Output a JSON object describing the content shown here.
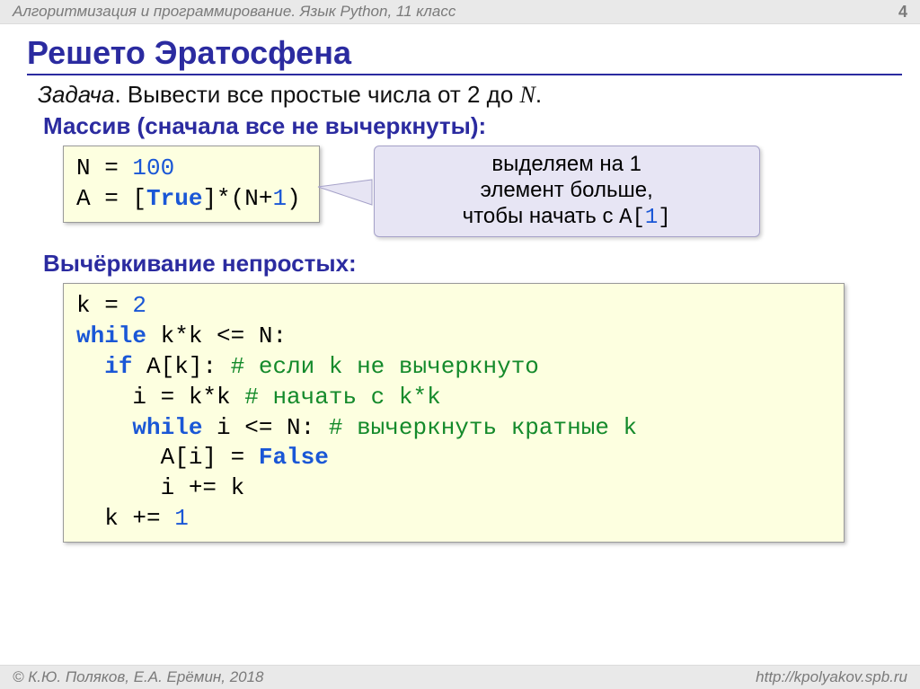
{
  "header": {
    "course": "Алгоритмизация и программирование. Язык Python, 11 класс",
    "page": "4"
  },
  "title": "Решето Эратосфена",
  "task": {
    "label": "Задача",
    "body_before": ". Вывести все простые числа от 2 до ",
    "N": "N",
    "body_after": "."
  },
  "subhead_array": "Массив (сначала все не вычеркнуты):",
  "code1": {
    "l1a": "N",
    "l1b": " = ",
    "l1c": "100",
    "l2a": "A",
    "l2b": " = [",
    "l2c": "True",
    "l2d": "]*(N+",
    "l2e": "1",
    "l2f": ")"
  },
  "note": {
    "line1": "выделяем на 1",
    "line2": "элемент больше,",
    "line3a": "чтобы начать с ",
    "line3b": "A[",
    "line3c": "1",
    "line3d": "]"
  },
  "subhead_cross": "Вычёркивание непростых:",
  "code2": {
    "l1a": "k",
    "l1b": " = ",
    "l1c": "2",
    "l2a": "while",
    "l2b": " k*k <= N:",
    "l3a": "  ",
    "l3b": "if",
    "l3c": " A[k]: ",
    "l3d": "# если k не вычеркнуто",
    "l4a": "    i",
    "l4b": " = ",
    "l4c": "k*k ",
    "l4d": "# начать с k*k",
    "l5a": "    ",
    "l5b": "while",
    "l5c": " i <= N: ",
    "l5d": "# вычеркнуть кратные k",
    "l6a": "      A[i]",
    "l6b": " = ",
    "l6c": "False",
    "l7a": "      i",
    "l7b": " += ",
    "l7c": "k",
    "l8a": "  k",
    "l8b": " += ",
    "l8c": "1"
  },
  "footer": {
    "copyright": "© К.Ю. Поляков, Е.А. Ерёмин, 2018",
    "url": "http://kpolyakov.spb.ru"
  }
}
